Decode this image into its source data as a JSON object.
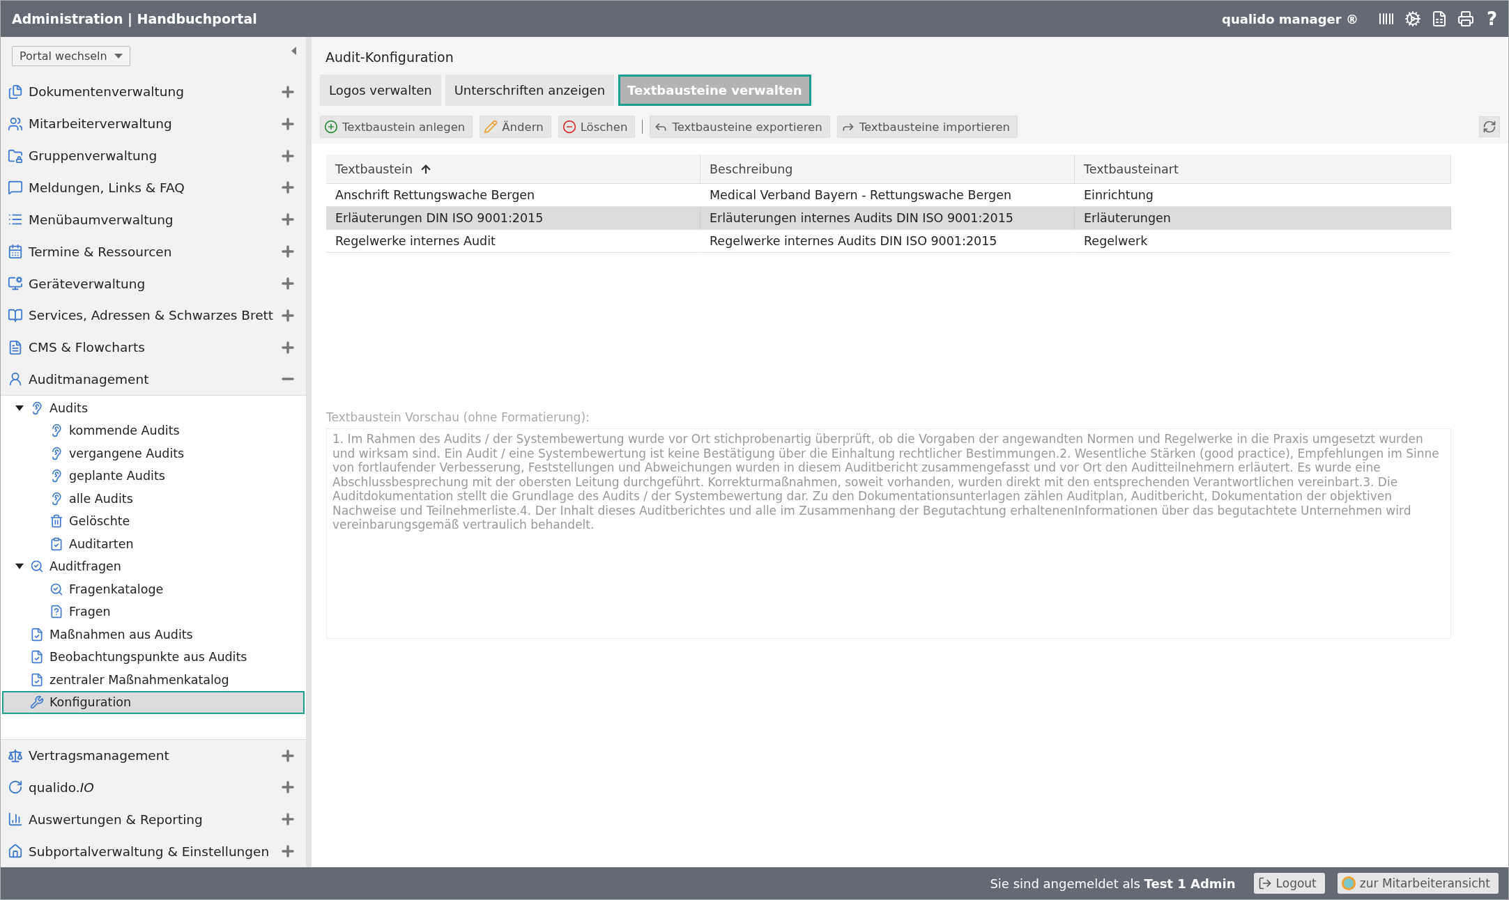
{
  "header": {
    "title": "Administration | Handbuchportal",
    "brand": "qualido manager ®",
    "help_glyph": "?"
  },
  "sidebar": {
    "portal_button": "Portal wechseln",
    "menu": [
      {
        "label": "Dokumentenverwaltung",
        "expanded": false
      },
      {
        "label": "Mitarbeiterverwaltung",
        "expanded": false
      },
      {
        "label": "Gruppenverwaltung",
        "expanded": false
      },
      {
        "label": "Meldungen, Links & FAQ",
        "expanded": false
      },
      {
        "label": "Menübaumverwaltung",
        "expanded": false
      },
      {
        "label": "Termine & Ressourcen",
        "expanded": false
      },
      {
        "label": "Geräteverwaltung",
        "expanded": false
      },
      {
        "label": "Services, Adressen & Schwarzes Brett",
        "expanded": false
      },
      {
        "label": "CMS & Flowcharts",
        "expanded": false
      },
      {
        "label": "Auditmanagement",
        "expanded": true,
        "children": [
          {
            "label": "Audits",
            "expanded": true,
            "selected": false,
            "children": [
              {
                "label": "kommende Audits",
                "selected": false
              },
              {
                "label": "vergangene Audits",
                "selected": false
              },
              {
                "label": "geplante Audits",
                "selected": false
              },
              {
                "label": "alle Audits",
                "selected": false
              },
              {
                "label": "Gelöschte",
                "selected": false
              },
              {
                "label": "Auditarten",
                "selected": false
              }
            ]
          },
          {
            "label": "Auditfragen",
            "expanded": true,
            "selected": false,
            "children": [
              {
                "label": "Fragenkataloge",
                "selected": false
              },
              {
                "label": "Fragen",
                "selected": false
              }
            ]
          },
          {
            "label": "Maßnahmen aus Audits",
            "selected": false
          },
          {
            "label": "Beobachtungspunkte aus Audits",
            "selected": false
          },
          {
            "label": "zentraler Maßnahmenkatalog",
            "selected": false
          },
          {
            "label": "Konfiguration",
            "selected": true
          }
        ]
      },
      {
        "label": "Vertragsmanagement",
        "expanded": false
      },
      {
        "label": "qualido.*IO*",
        "expanded": false
      },
      {
        "label": "Auswertungen & Reporting",
        "expanded": false
      },
      {
        "label": "Subportalverwaltung & Einstellungen",
        "expanded": false
      }
    ]
  },
  "main": {
    "title": "Audit-Konfiguration",
    "tabs": [
      {
        "label": "Logos verwalten",
        "selected": false
      },
      {
        "label": "Unterschriften anzeigen",
        "selected": false
      },
      {
        "label": "Textbausteine verwalten",
        "selected": true
      }
    ],
    "toolbar": [
      {
        "label": "Textbaustein anlegen",
        "kind": "add"
      },
      {
        "label": "Ändern",
        "kind": "edit"
      },
      {
        "label": "Löschen",
        "kind": "delete"
      },
      {
        "label": "Textbausteine exportieren",
        "kind": "export"
      },
      {
        "label": "Textbausteine importieren",
        "kind": "import"
      }
    ],
    "table": {
      "columns": [
        {
          "label": "Textbaustein",
          "sorted": true
        },
        {
          "label": "Beschreibung",
          "sorted": false
        },
        {
          "label": "Textbausteinart",
          "sorted": false
        }
      ],
      "rows": [
        {
          "cells": [
            "Anschrift Rettungswache Bergen",
            "Medical Verband Bayern - Rettungswache Bergen",
            "Einrichtung"
          ],
          "selected": false
        },
        {
          "cells": [
            "Erläuterungen DIN ISO 9001:2015",
            "Erläuterungen internes Audits DIN ISO 9001:2015",
            "Erläuterungen"
          ],
          "selected": true
        },
        {
          "cells": [
            "Regelwerke internes Audit",
            "Regelwerke internes Audits DIN ISO 9001:2015",
            "Regelwerk"
          ],
          "selected": false
        }
      ]
    },
    "preview": {
      "label": "Textbaustein Vorschau (ohne Formatierung):",
      "text": "1. Im Rahmen des Audits / der Systembewertung wurde vor Ort stichprobenartig überprüft, ob die Vorgaben der angewandten Normen und Regelwerke in die Praxis umgesetzt wurden und wirksam sind. Ein Audit / eine Systembewertung ist keine Bestätigung über die Einhaltung rechtlicher Bestimmungen.2. Wesentliche Stärken (good practice), Empfehlungen im Sinne von fortlaufender Verbesserung, Feststellungen und Abweichungen wurden in diesem Auditbericht zusammengefasst und vor Ort den Auditteilnehmern erläutert. Es wurde eine Abschlussbesprechung mit der obersten Leitung durchgeführt. Korrekturmaßnahmen, soweit vorhanden, wurden direkt mit den entsprechenden Verantwortlichen vereinbart.3. Die Auditdokumentation stellt die Grundlage des Audits / der Systembewertung dar. Zu den Dokumentationsunterlagen zählen Auditplan, Auditbericht, Dokumentation der objektiven Nachweise und Teilnehmerliste.4. Der Inhalt dieses Auditberichtes und alle im Zusammenhang der Begutachtung erhaltenenInformationen über das begutachtete Unternehmen wird vereinbarungsgemäß vertraulich behandelt."
    }
  },
  "footer": {
    "login_text": "Sie sind angemeldet als **Test 1 Admin**",
    "buttons": [
      {
        "label": "Logout",
        "kind": "logout"
      },
      {
        "label": "zur Mitarbeiteransicht",
        "kind": "switch"
      }
    ]
  }
}
